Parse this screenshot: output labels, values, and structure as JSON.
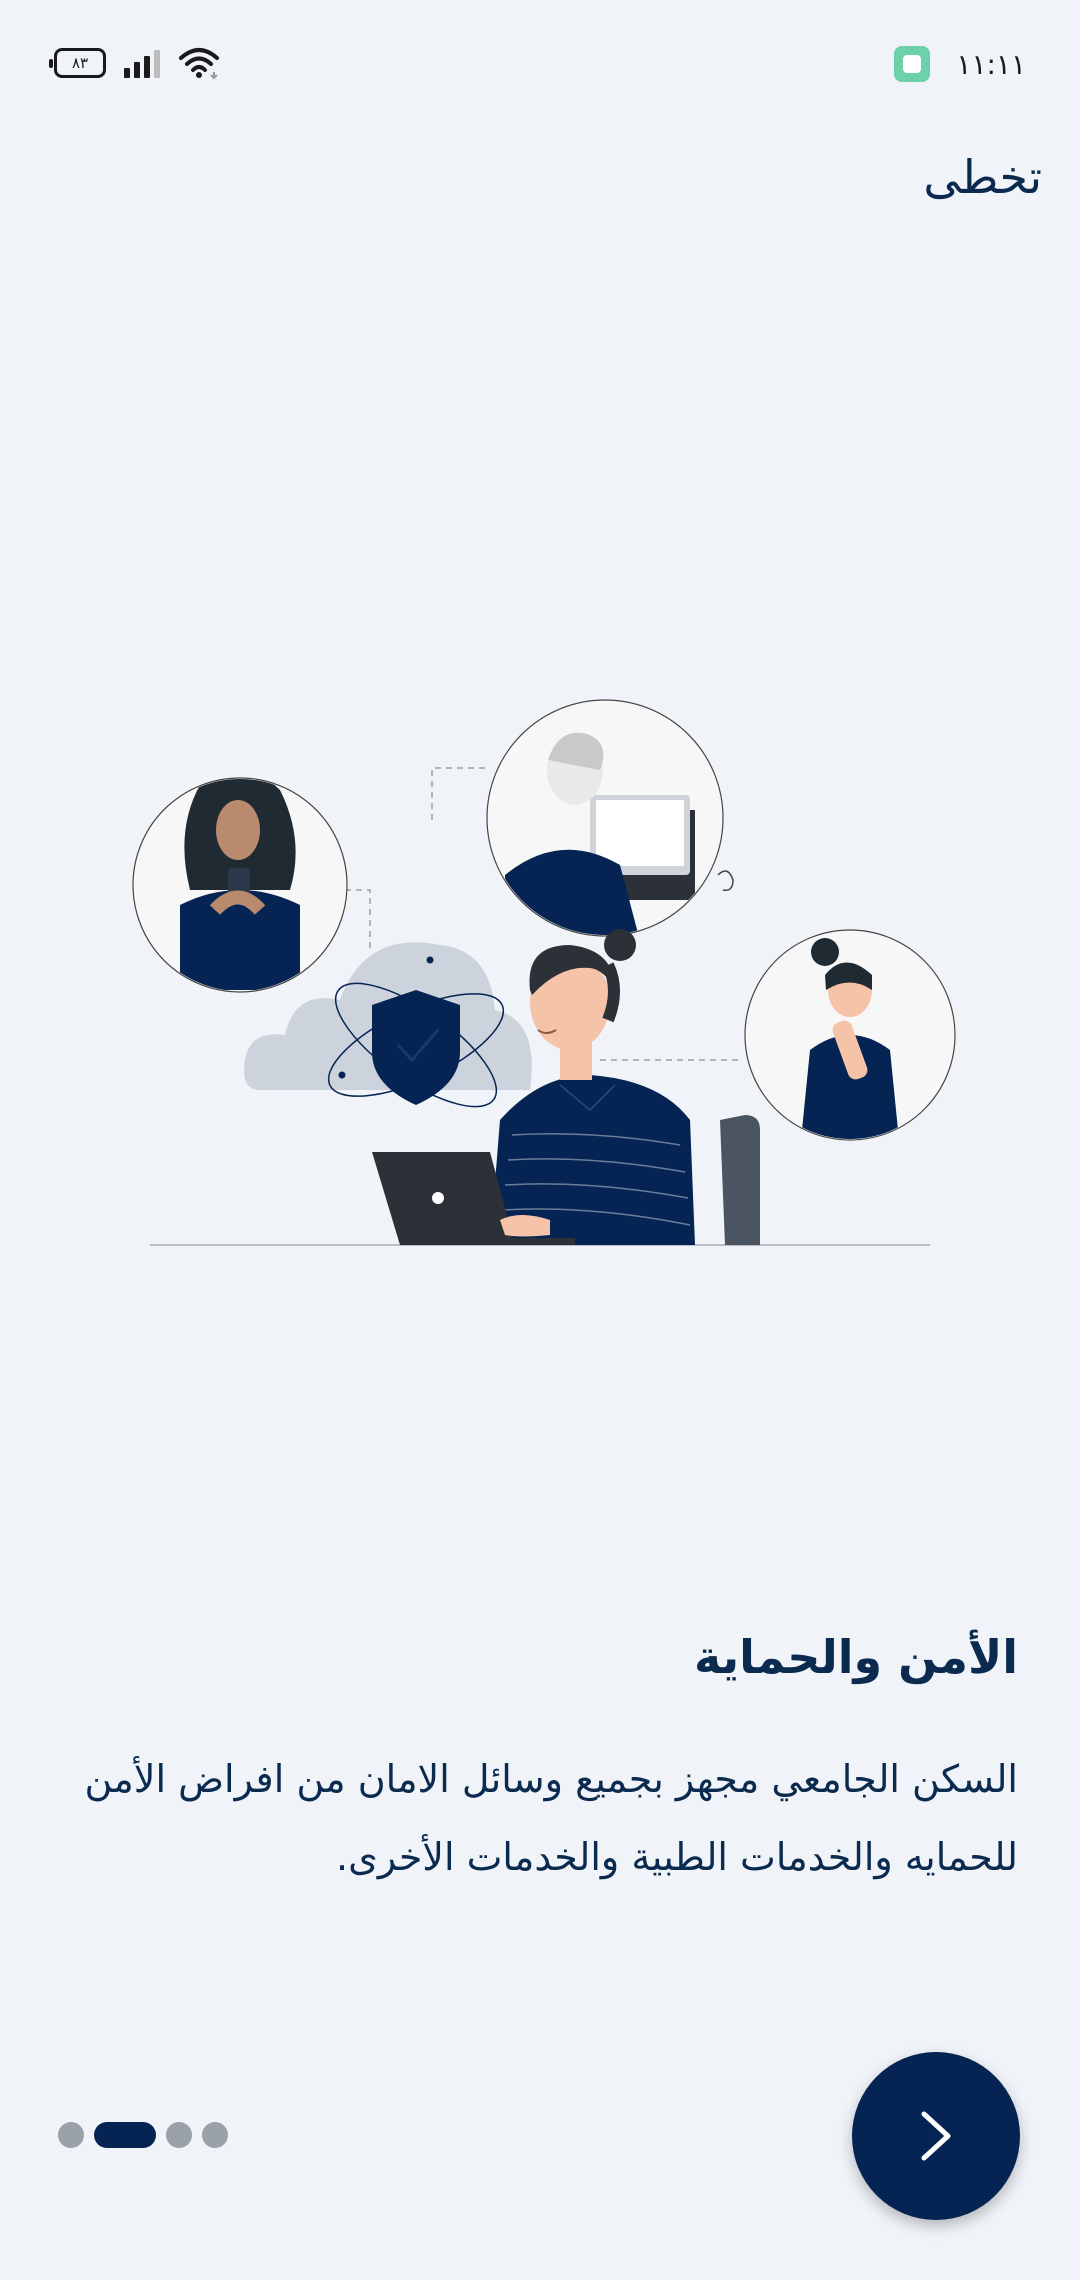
{
  "status_bar": {
    "battery": "٨٣",
    "time": "١١:١١"
  },
  "header": {
    "skip_label": "تخطى"
  },
  "illustration": {
    "icon": "security-team-illustration"
  },
  "content": {
    "title": "الأمن والحماية",
    "description": "السكن الجامعي مجهز بجميع وسائل الامان من افراض الأمن للحمايه والخدمات الطبية والخدمات الأخرى."
  },
  "pager": {
    "total_pages": 4,
    "current_page": 2
  },
  "next_button": {
    "icon": "chevron-right-icon"
  },
  "colors": {
    "background": "#f0f3f8",
    "primary": "#052453",
    "inactive_dot": "#9aa0a8"
  }
}
